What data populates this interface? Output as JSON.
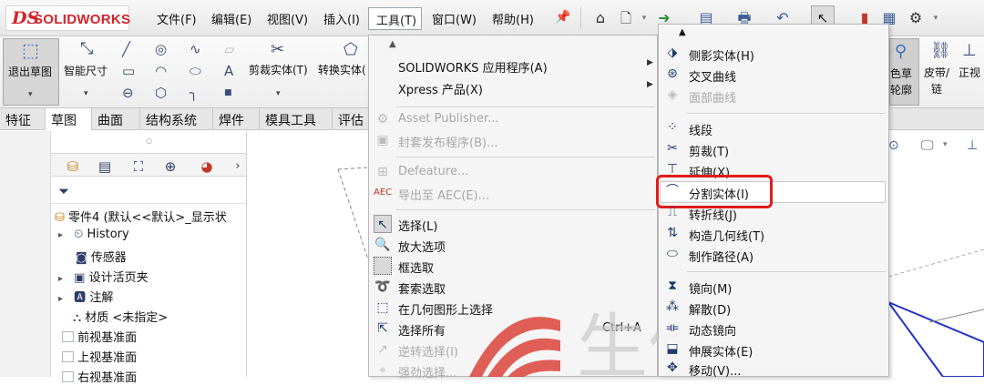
{
  "titlebar": {
    "logo_ds": "DS",
    "logo_text": "SOLIDWORKS",
    "menus": [
      "文件(F)",
      "编辑(E)",
      "视图(V)",
      "插入(I)",
      "工具(T)",
      "窗口(W)",
      "帮助(H)"
    ],
    "pin_icon": "pin-icon"
  },
  "commandbar": {
    "exit_sketch": "退出草图",
    "smart_dimension": "智能尺寸",
    "trim_entities": "剪裁实体(T)",
    "convert_entities": "转换实体(",
    "right_btn1_line1": "色草",
    "right_btn1_line2": "轮廓",
    "right_btn2_line1": "皮带/",
    "right_btn2_line2": "链",
    "right_btn3": "正视"
  },
  "tabs": [
    "特征",
    "草图",
    "曲面",
    "结构系统",
    "焊件",
    "模具工具",
    "评估"
  ],
  "active_tab_index": 1,
  "tree": {
    "root": "零件4 (默认<<默认>_显示状",
    "items": [
      {
        "label": "History",
        "expand": true
      },
      {
        "label": "传感器",
        "expand": false
      },
      {
        "label": "设计活页夹",
        "expand": true
      },
      {
        "label": "注解",
        "expand": true
      },
      {
        "label": "材质 <未指定>",
        "expand": false
      },
      {
        "label": "前视基准面",
        "expand": false
      },
      {
        "label": "上视基准面",
        "expand": false
      },
      {
        "label": "右视基准面",
        "expand": false
      }
    ]
  },
  "tools_menu": {
    "items": [
      {
        "label": "SOLIDWORKS 应用程序(A)",
        "disabled": false,
        "submenu": true
      },
      {
        "label": "Xpress 产品(X)",
        "disabled": false,
        "submenu": true
      },
      {
        "label": "Asset Publisher...",
        "disabled": true
      },
      {
        "label": "封套发布程序(B)...",
        "disabled": true
      },
      {
        "label": "Defeature...",
        "disabled": true
      },
      {
        "label": "导出至 AEC(E)...",
        "disabled": true
      },
      {
        "label": "选择(L)",
        "disabled": false
      },
      {
        "label": "放大选项",
        "disabled": false
      },
      {
        "label": "框选取",
        "disabled": false
      },
      {
        "label": "套索选取",
        "disabled": false
      },
      {
        "label": "在几何图形上选择",
        "disabled": false
      },
      {
        "label": "选择所有",
        "disabled": false,
        "shortcut": "Ctrl+A"
      },
      {
        "label": "逆转选择(I)",
        "disabled": true
      },
      {
        "label": "强劲选择...",
        "disabled": true
      }
    ]
  },
  "sketch_tools_menu": {
    "items": [
      {
        "label": "侧影实体(H)",
        "disabled": false
      },
      {
        "label": "交叉曲线",
        "disabled": false
      },
      {
        "label": "面部曲线",
        "disabled": true
      },
      {
        "label": "线段",
        "disabled": false
      },
      {
        "label": "剪裁(T)",
        "disabled": false
      },
      {
        "label": "延伸(X)",
        "disabled": false
      },
      {
        "label": "分割实体(I)",
        "disabled": false,
        "highlighted": true
      },
      {
        "label": "转折线(J)",
        "disabled": false
      },
      {
        "label": "构造几何线(T)",
        "disabled": false
      },
      {
        "label": "制作路径(A)",
        "disabled": false
      },
      {
        "label": "镜向(M)",
        "disabled": false
      },
      {
        "label": "解散(D)",
        "disabled": false
      },
      {
        "label": "动态镜向",
        "disabled": false
      },
      {
        "label": "伸展实体(E)",
        "disabled": false
      },
      {
        "label": "移动(V)...",
        "disabled": false
      }
    ]
  },
  "watermark": {
    "text": "生信科技",
    "color": "#d9342b"
  },
  "colors": {
    "highlight_box": "#e11b1b",
    "logo": "#d2232a",
    "menu_bg": "#f5f5f5"
  }
}
